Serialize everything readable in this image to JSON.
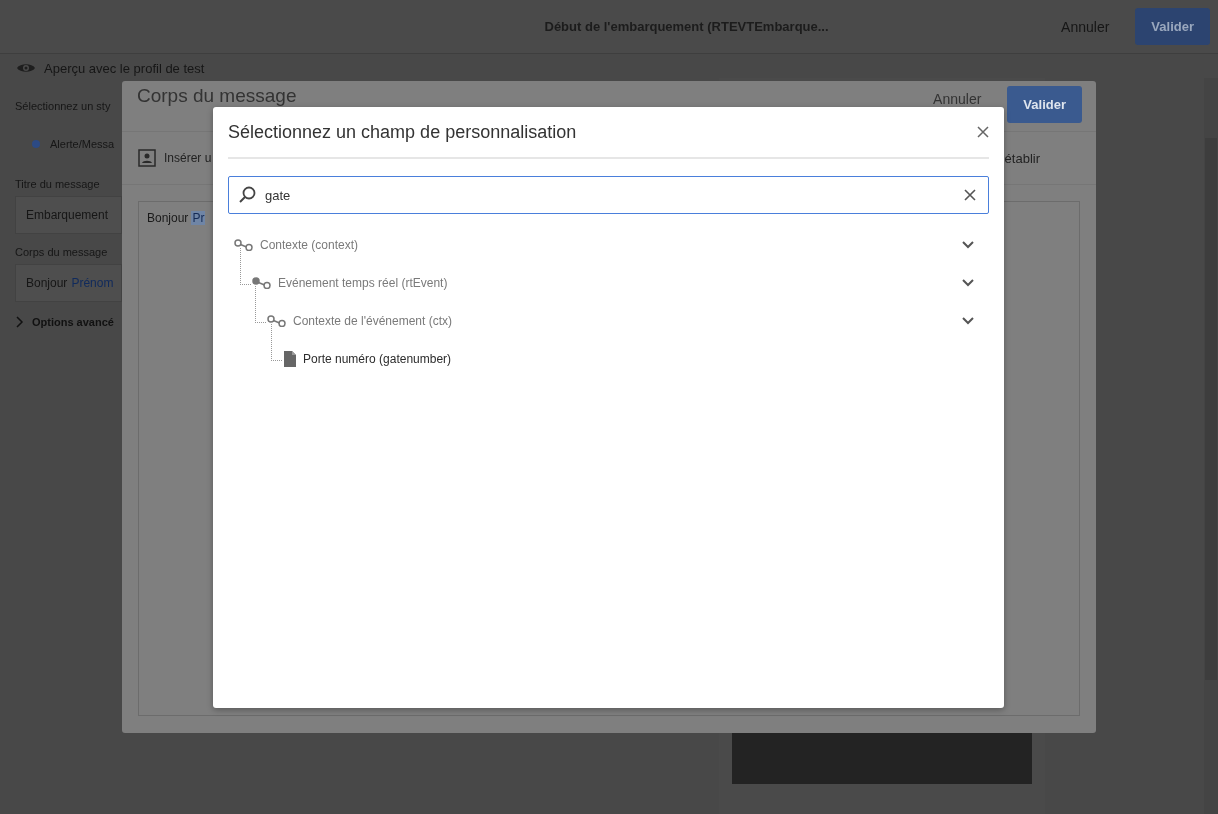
{
  "page": {
    "title": "Début de l'embarquement (RTEVTEmbarque...",
    "cancel": "Annuler",
    "confirm": "Valider",
    "preview_label": "Aperçu avec le profil de test",
    "style_label": "Sélectionnez un sty",
    "style_option": {
      "label": "Alerte/Messa",
      "selected": true
    },
    "fields": [
      {
        "label": "Titre du message",
        "value": "Embarquement"
      },
      {
        "label": "Corps du message",
        "value": "Bonjour",
        "token": "Prénom"
      }
    ],
    "advanced": {
      "label": "Options avancé",
      "expanded": false
    }
  },
  "message_dialog": {
    "title": "Corps du message",
    "cancel": "Annuler",
    "confirm": "Valider",
    "insert_label": "Insérer u",
    "reset_label": "établir",
    "body_text": "Bonjour",
    "body_token": "Pr"
  },
  "field_dialog": {
    "title": "Sélectionnez un champ de personnalisation",
    "search": {
      "value": "gate"
    },
    "tree": [
      {
        "label": "Contexte (context)",
        "kind": "link",
        "expanded": true,
        "children": [
          {
            "label": "Evénement temps réel (rtEvent)",
            "kind": "link",
            "expanded": true,
            "children": [
              {
                "label": "Contexte de l'événement (ctx)",
                "kind": "link",
                "expanded": true,
                "children": [
                  {
                    "label": "Porte numéro (gatenumber)",
                    "kind": "field"
                  }
                ]
              }
            ]
          }
        ]
      }
    ]
  }
}
